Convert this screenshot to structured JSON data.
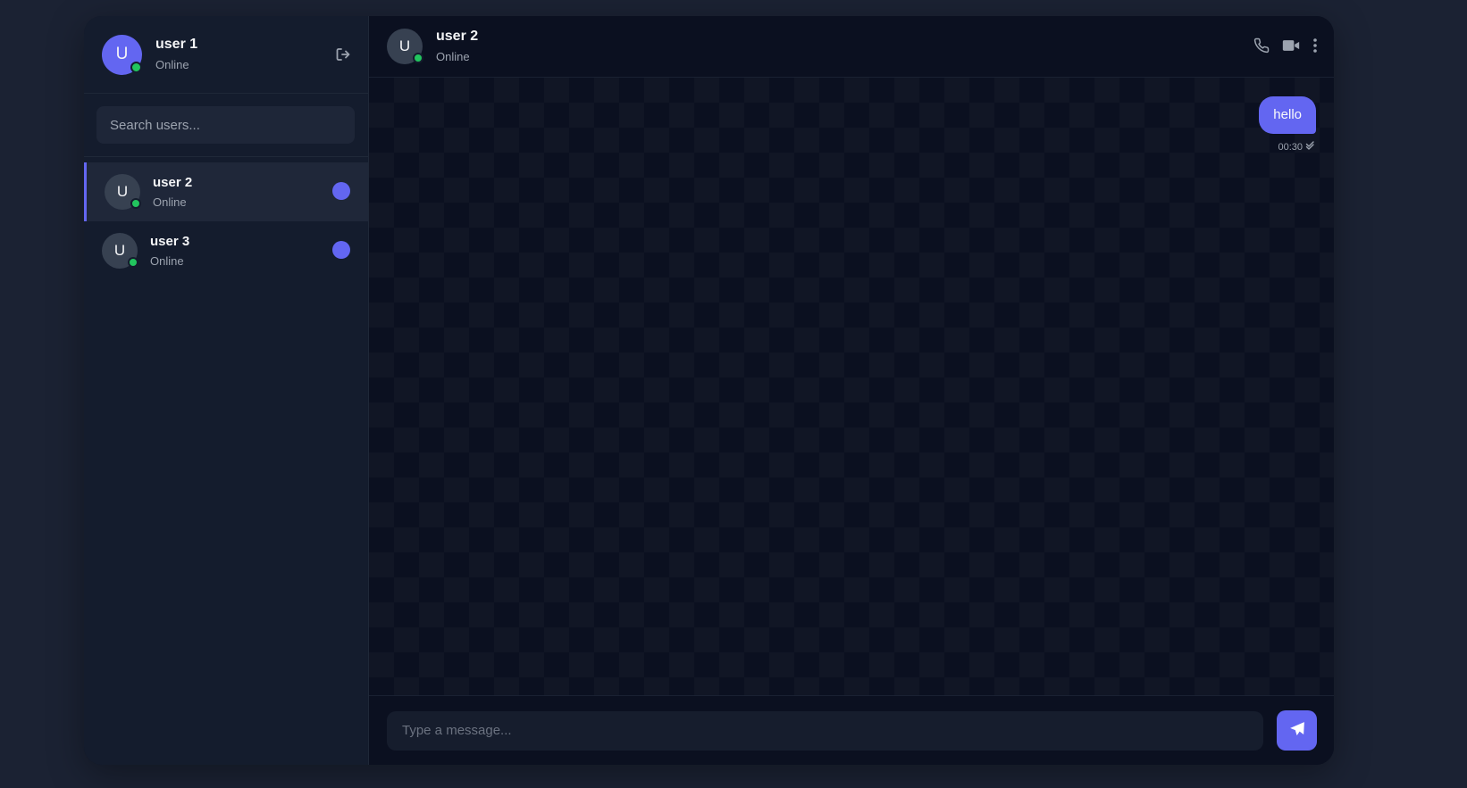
{
  "current_user": {
    "initial": "U",
    "name": "user 1",
    "status": "Online"
  },
  "search": {
    "placeholder": "Search users..."
  },
  "users": [
    {
      "initial": "U",
      "name": "user 2",
      "status": "Online",
      "active": true,
      "unread": true
    },
    {
      "initial": "U",
      "name": "user 3",
      "status": "Online",
      "active": false,
      "unread": true
    }
  ],
  "chat": {
    "initial": "U",
    "name": "user 2",
    "status": "Online",
    "messages": [
      {
        "text": "hello",
        "time": "00:30",
        "from_me": true,
        "read_icon": "double-check-icon"
      }
    ]
  },
  "composer": {
    "placeholder": "Type a message..."
  },
  "icons": {
    "logout": "logout-icon",
    "call": "phone-icon",
    "video": "video-camera-icon",
    "more": "more-vertical-icon",
    "send": "send-icon"
  },
  "colors": {
    "accent": "#6366f1",
    "online": "#22c55e",
    "background": "#1b2233"
  }
}
